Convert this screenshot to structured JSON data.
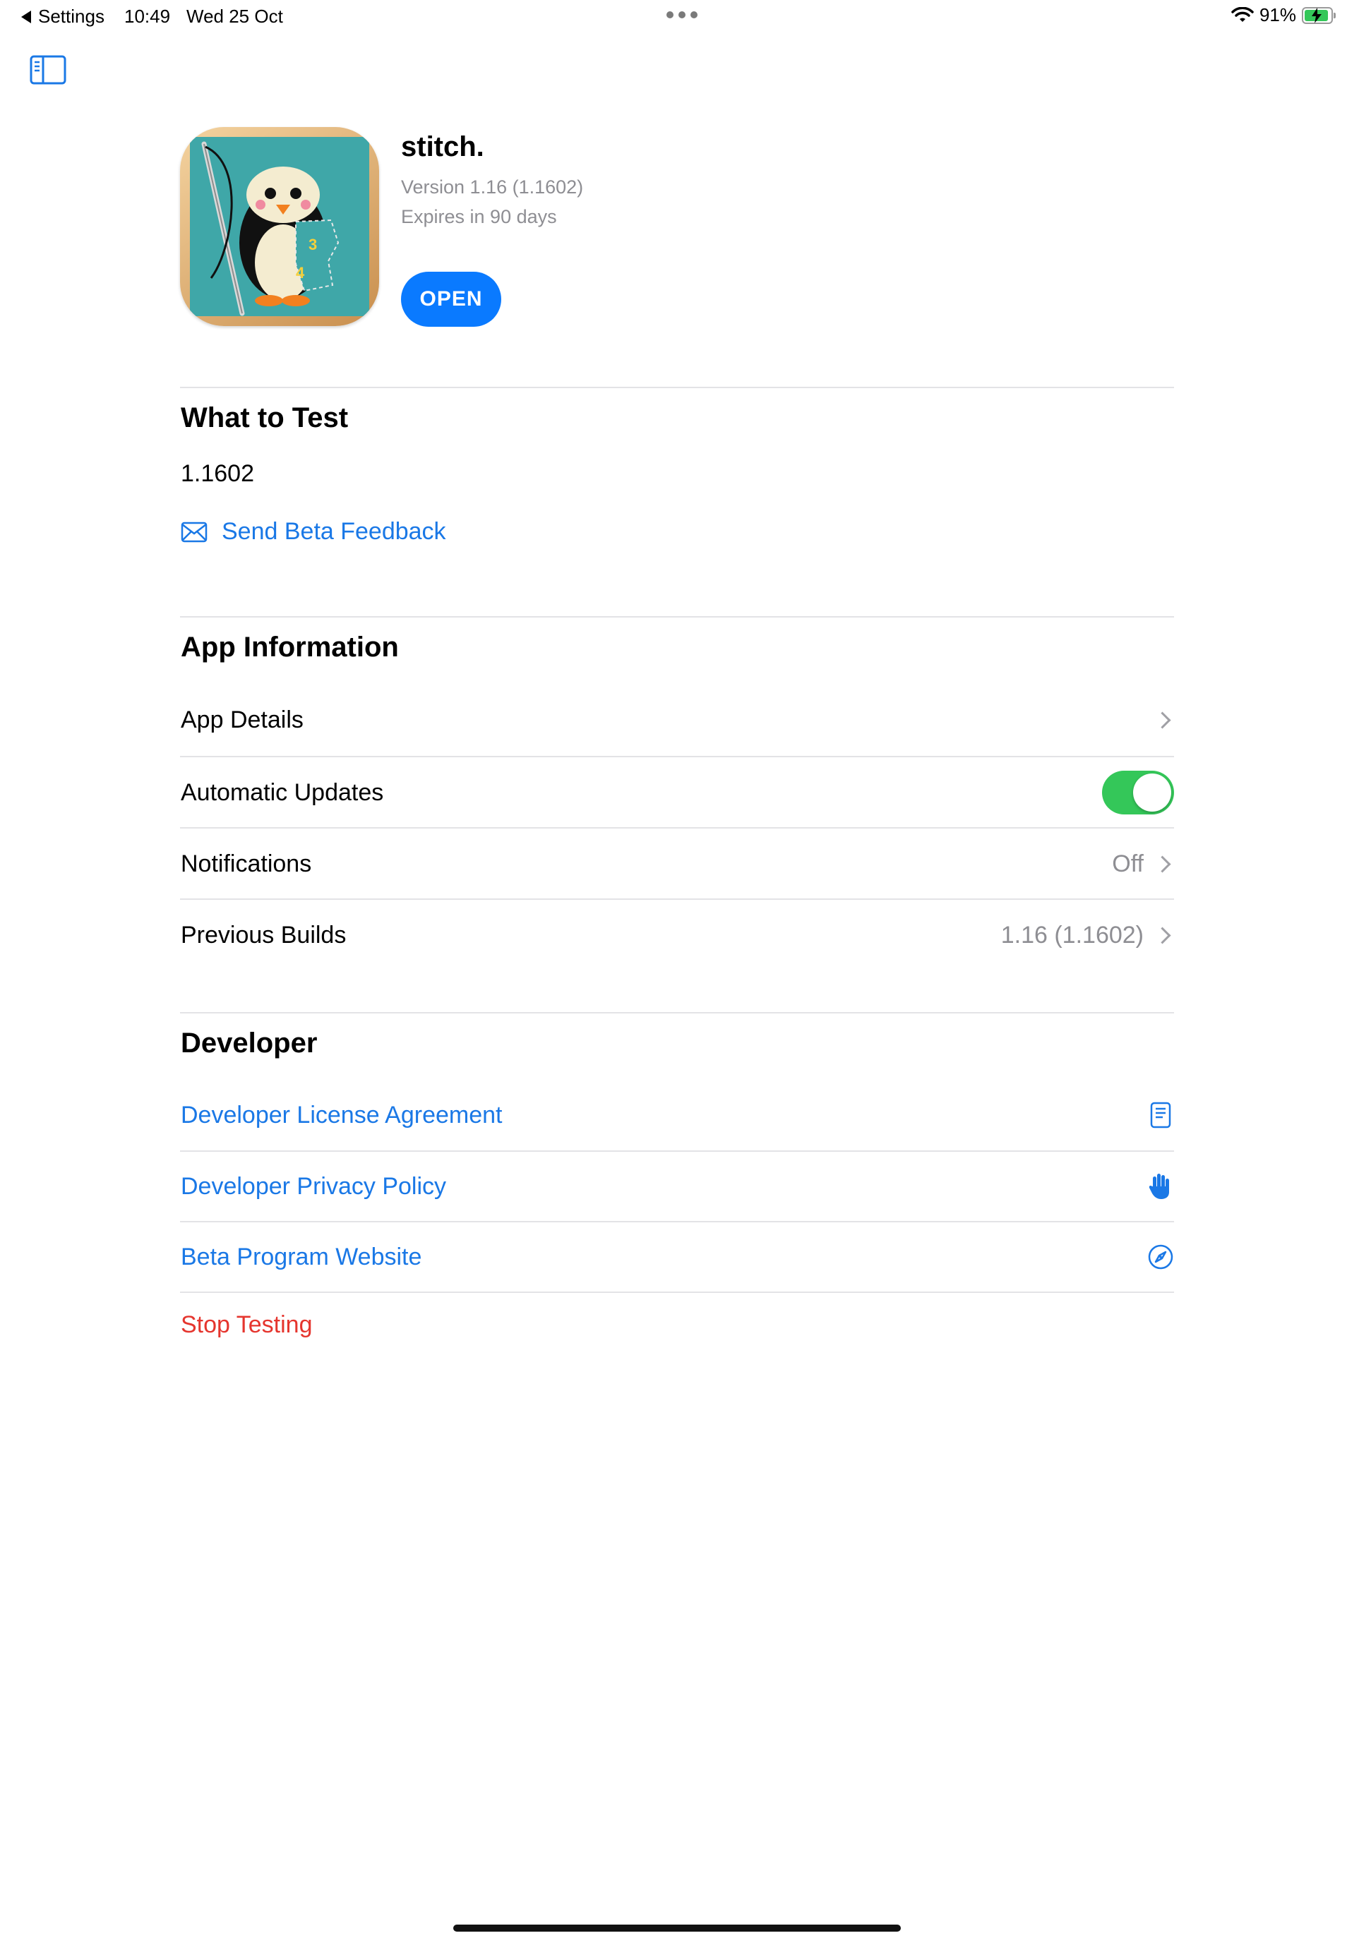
{
  "status_bar": {
    "back_label": "Settings",
    "time": "10:49",
    "date": "Wed 25 Oct",
    "battery": "91%",
    "battery_level": 0.91
  },
  "app": {
    "name": "stitch.",
    "version": "Version 1.16 (1.1602)",
    "expires": "Expires in 90 days",
    "open_label": "OPEN",
    "icon": "penguin-embroidery-app-icon",
    "icon_digits": [
      "3",
      "4"
    ]
  },
  "what_to_test": {
    "title": "What to Test",
    "build": "1.1602",
    "feedback_label": "Send Beta Feedback"
  },
  "app_information": {
    "title": "App Information",
    "rows": [
      {
        "label": "App Details",
        "value": ""
      },
      {
        "label": "Automatic Updates",
        "toggle_on": true
      },
      {
        "label": "Notifications",
        "value": "Off"
      },
      {
        "label": "Previous Builds",
        "value": "1.16 (1.1602)"
      }
    ]
  },
  "developer": {
    "title": "Developer",
    "rows": [
      {
        "label": "Developer License Agreement",
        "icon": "document-icon"
      },
      {
        "label": "Developer Privacy Policy",
        "icon": "hand-raised-icon"
      },
      {
        "label": "Beta Program Website",
        "icon": "compass-icon"
      }
    ],
    "stop_label": "Stop Testing"
  },
  "colors": {
    "accent": "#1a78e6",
    "button": "#0a7aff",
    "toggle_on": "#34c759",
    "destructive": "#e5352e"
  }
}
